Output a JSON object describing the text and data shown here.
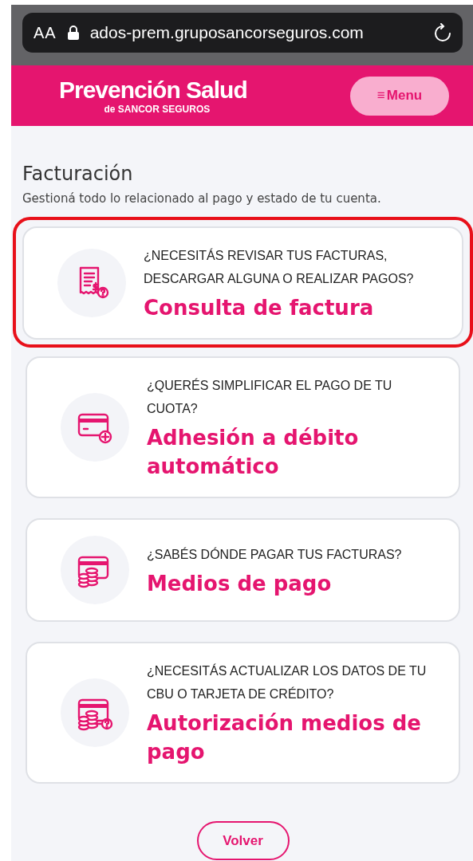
{
  "browser": {
    "text_size_button": "AA",
    "url": "ados-prem.gruposancorseguros.com"
  },
  "header": {
    "logo_title": "Prevención Salud",
    "logo_subtitle": "de SANCOR SEGUROS",
    "menu_icon": "≡",
    "menu_label": "Menu"
  },
  "page": {
    "title": "Facturación",
    "subtitle": "Gestioná todo lo relacionado al pago y estado de tu cuenta."
  },
  "cards": [
    {
      "kind": "receipt",
      "question": "¿NECESITÁS REVISAR TUS FACTURAS, DESCARGAR ALGUNA O REALIZAR PAGOS?",
      "title": "Consulta de factura",
      "highlighted": true
    },
    {
      "kind": "card-plus",
      "question": "¿QUERÉS SIMPLIFICAR EL PAGO DE TU CUOTA?",
      "title": "Adhesión a débito automático",
      "highlighted": false
    },
    {
      "kind": "card-coins",
      "question": "¿SABÉS DÓNDE PAGAR TUS FACTURAS?",
      "title": "Medios de pago",
      "highlighted": false
    },
    {
      "kind": "card-coins-question",
      "question": "¿NECESITÁS ACTUALIZAR LOS DATOS DE TU CBU O TARJETA DE CRÉDITO?",
      "title": "Autorización medios de pago",
      "highlighted": false
    }
  ],
  "back_button": "Volver"
}
